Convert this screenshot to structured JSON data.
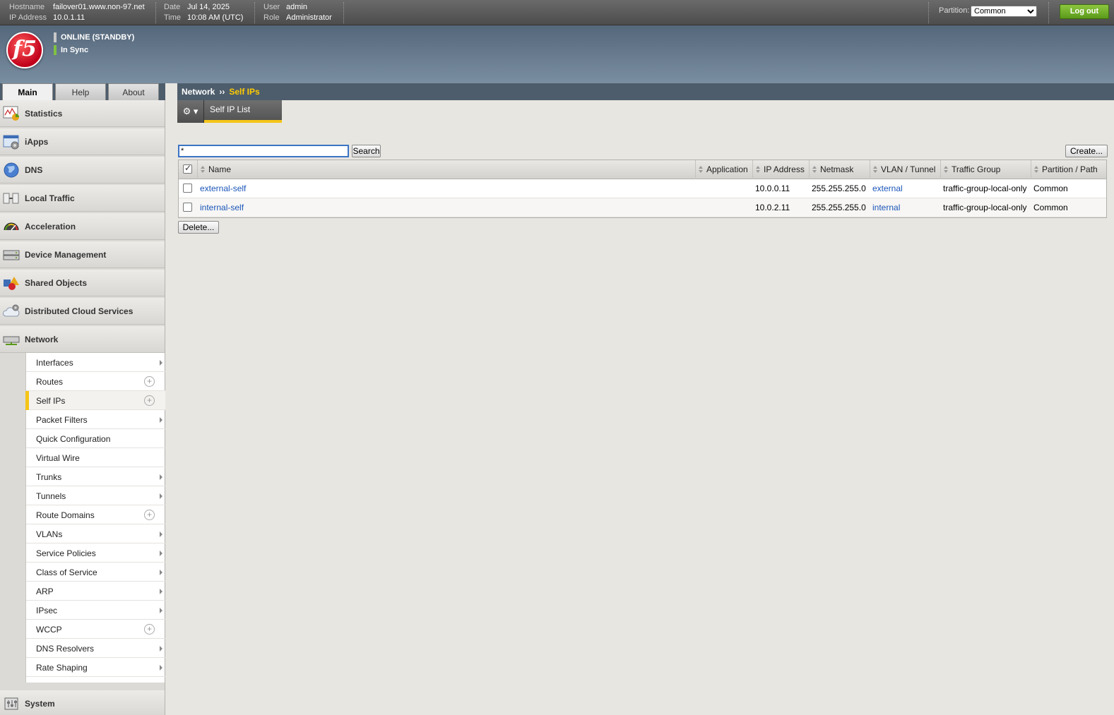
{
  "header": {
    "hostname_label": "Hostname",
    "hostname": "failover01.www.non-97.net",
    "ip_label": "IP Address",
    "ip": "10.0.1.11",
    "date_label": "Date",
    "date": "Jul 14, 2025",
    "time_label": "Time",
    "time": "10:08 AM (UTC)",
    "user_label": "User",
    "user": "admin",
    "role_label": "Role",
    "role": "Administrator",
    "partition_label": "Partition:",
    "partition_value": "Common",
    "logout_label": "Log out"
  },
  "banner": {
    "logo_text": "f5",
    "status_online": "ONLINE (STANDBY)",
    "status_sync": "In Sync",
    "status_colors": {
      "online": "#c8c8c8",
      "sync": "#7fc241"
    }
  },
  "tabs": [
    {
      "label": "Main",
      "active": true
    },
    {
      "label": "Help",
      "active": false
    },
    {
      "label": "About",
      "active": false
    }
  ],
  "breadcrumb": {
    "parent": "Network",
    "separator": "››",
    "current": "Self IPs"
  },
  "nav": {
    "items": [
      {
        "label": "Statistics",
        "icon": "statistics-icon"
      },
      {
        "label": "iApps",
        "icon": "iapps-icon"
      },
      {
        "label": "DNS",
        "icon": "globe-icon"
      },
      {
        "label": "Local Traffic",
        "icon": "local-traffic-icon"
      },
      {
        "label": "Acceleration",
        "icon": "speedometer-icon"
      },
      {
        "label": "Device Management",
        "icon": "device-icon"
      },
      {
        "label": "Shared Objects",
        "icon": "shapes-icon"
      },
      {
        "label": "Distributed Cloud Services",
        "icon": "cloud-gear-icon"
      },
      {
        "label": "Network",
        "icon": "network-icon"
      }
    ],
    "network_sub": [
      {
        "label": "Interfaces",
        "marker": "arrow"
      },
      {
        "label": "Routes",
        "marker": "plus"
      },
      {
        "label": "Self IPs",
        "marker": "plus",
        "active": true
      },
      {
        "label": "Packet Filters",
        "marker": "arrow"
      },
      {
        "label": "Quick Configuration",
        "marker": "none"
      },
      {
        "label": "Virtual Wire",
        "marker": "none"
      },
      {
        "label": "Trunks",
        "marker": "arrow"
      },
      {
        "label": "Tunnels",
        "marker": "arrow"
      },
      {
        "label": "Route Domains",
        "marker": "plus"
      },
      {
        "label": "VLANs",
        "marker": "arrow"
      },
      {
        "label": "Service Policies",
        "marker": "arrow"
      },
      {
        "label": "Class of Service",
        "marker": "arrow"
      },
      {
        "label": "ARP",
        "marker": "arrow"
      },
      {
        "label": "IPsec",
        "marker": "arrow"
      },
      {
        "label": "WCCP",
        "marker": "plus"
      },
      {
        "label": "DNS Resolvers",
        "marker": "arrow"
      },
      {
        "label": "Rate Shaping",
        "marker": "arrow"
      }
    ],
    "system_label": "System",
    "system_icon": "system-icon"
  },
  "subtab": {
    "gear_icon": "gear-icon",
    "label": "Self IP List"
  },
  "search": {
    "value": "*",
    "button_label": "Search"
  },
  "create_label": "Create...",
  "delete_label": "Delete...",
  "table": {
    "columns": [
      "Name",
      "Application",
      "IP Address",
      "Netmask",
      "VLAN / Tunnel",
      "Traffic Group",
      "Partition / Path"
    ],
    "rows": [
      {
        "name": "external-self",
        "application": "",
        "ip": "10.0.0.11",
        "netmask": "255.255.255.0",
        "vlan": "external",
        "traffic_group": "traffic-group-local-only",
        "partition": "Common"
      },
      {
        "name": "internal-self",
        "application": "",
        "ip": "10.0.2.11",
        "netmask": "255.255.255.0",
        "vlan": "internal",
        "traffic_group": "traffic-group-local-only",
        "partition": "Common"
      }
    ]
  }
}
